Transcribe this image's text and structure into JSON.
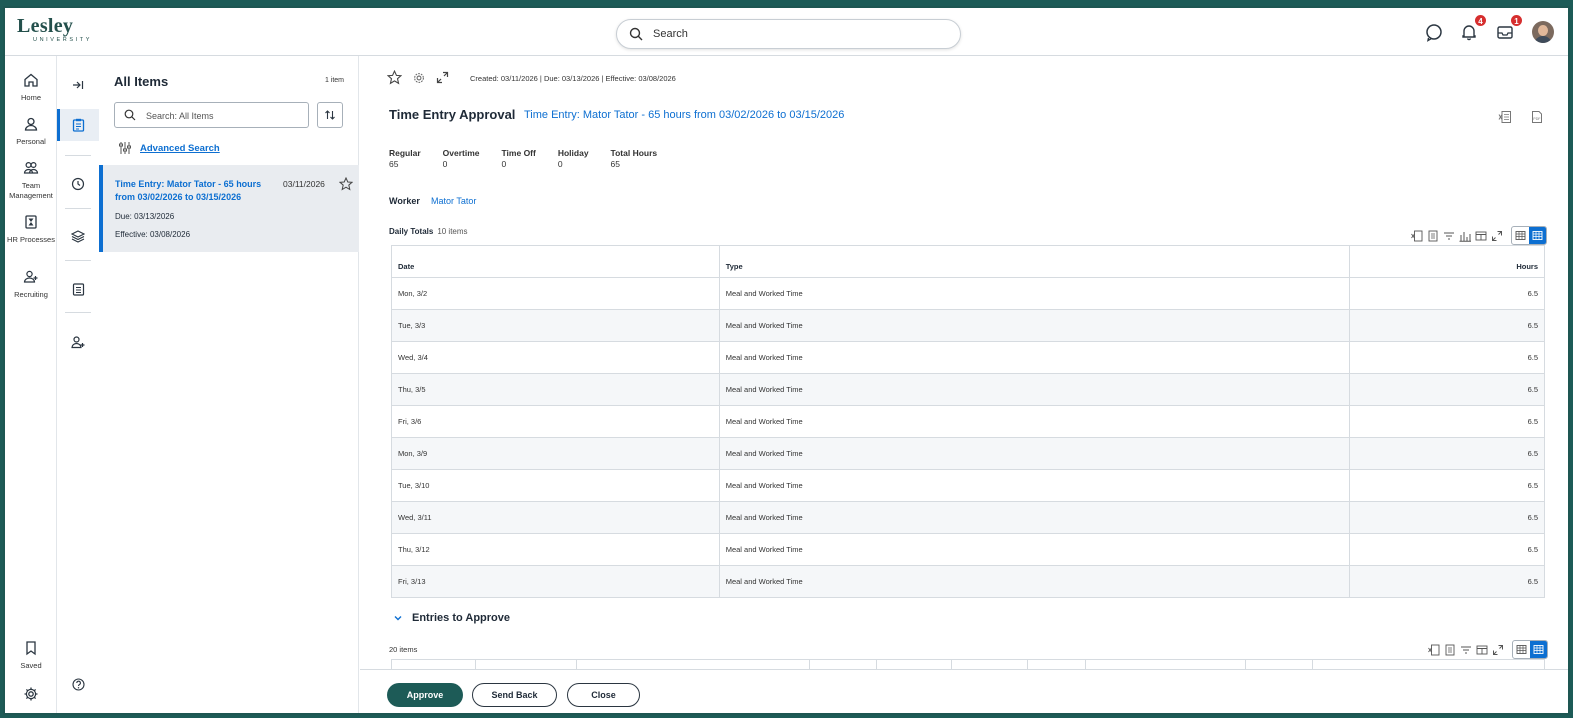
{
  "brand": {
    "line1": "Lesley",
    "line2": "UNIVERSITY",
    "accent": "#1d5b57"
  },
  "topbar": {
    "search_label": "Search",
    "notifications_count": "4",
    "inbox_count": "1"
  },
  "nav": {
    "home": "Home",
    "personal": "Personal",
    "team": "Team Management",
    "hr": "HR Processes",
    "recruiting": "Recruiting",
    "saved": "Saved"
  },
  "items_panel": {
    "title": "All Items",
    "count": "1 item",
    "search_placeholder": "Search: All Items",
    "advanced_search": "Advanced Search",
    "card": {
      "title": "Time Entry: Mator Tator - 65 hours from 03/02/2026 to 03/15/2026",
      "date": "03/11/2026",
      "due": "Due: 03/13/2026",
      "effective": "Effective: 03/08/2026"
    }
  },
  "main": {
    "meta": "Created: 03/11/2026 | Due: 03/13/2026 | Effective: 03/08/2026",
    "title": "Time Entry Approval",
    "title_link": "Time Entry: Mator Tator - 65 hours from 03/02/2026 to 03/15/2026",
    "summary": {
      "regular_label": "Regular",
      "regular_value": "65",
      "overtime_label": "Overtime",
      "overtime_value": "0",
      "timeoff_label": "Time Off",
      "timeoff_value": "0",
      "holiday_label": "Holiday",
      "holiday_value": "0",
      "total_label": "Total Hours",
      "total_value": "65"
    },
    "worker_label": "Worker",
    "worker_value": "Mator Tator",
    "daily_totals_label": "Daily Totals",
    "daily_totals_count": "10 items",
    "daily_headers": {
      "date": "Date",
      "type": "Type",
      "hours": "Hours"
    },
    "daily_rows": [
      {
        "date": "Mon, 3/2",
        "type": "Meal and Worked Time",
        "hours": "6.5"
      },
      {
        "date": "Tue, 3/3",
        "type": "Meal and Worked Time",
        "hours": "6.5"
      },
      {
        "date": "Wed, 3/4",
        "type": "Meal and Worked Time",
        "hours": "6.5"
      },
      {
        "date": "Thu, 3/5",
        "type": "Meal and Worked Time",
        "hours": "6.5"
      },
      {
        "date": "Fri, 3/6",
        "type": "Meal and Worked Time",
        "hours": "6.5"
      },
      {
        "date": "Mon, 3/9",
        "type": "Meal and Worked Time",
        "hours": "6.5"
      },
      {
        "date": "Tue, 3/10",
        "type": "Meal and Worked Time",
        "hours": "6.5"
      },
      {
        "date": "Wed, 3/11",
        "type": "Meal and Worked Time",
        "hours": "6.5"
      },
      {
        "date": "Thu, 3/12",
        "type": "Meal and Worked Time",
        "hours": "6.5"
      },
      {
        "date": "Fri, 3/13",
        "type": "Meal and Worked Time",
        "hours": "6.5"
      }
    ],
    "entries_title": "Entries to Approve",
    "entries_count": "20 items"
  },
  "footer": {
    "approve": "Approve",
    "send_back": "Send Back",
    "close": "Close"
  }
}
